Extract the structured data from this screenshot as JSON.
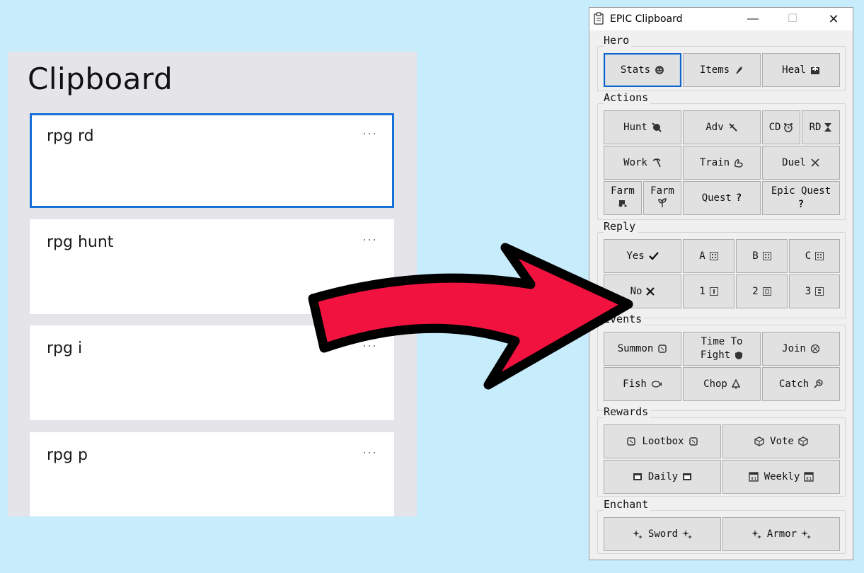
{
  "clipboard": {
    "title": "Clipboard",
    "more_label": "···",
    "items": [
      {
        "text": "rpg rd",
        "selected": true
      },
      {
        "text": "rpg hunt"
      },
      {
        "text": "rpg i"
      },
      {
        "text": "rpg p"
      }
    ]
  },
  "epic": {
    "window_title": "EPIC Clipboard",
    "controls": {
      "minimize": "—",
      "maximize": "☐",
      "close": "✕"
    },
    "hero": {
      "label": "Hero",
      "stats": "Stats",
      "items": "Items",
      "heal": "Heal"
    },
    "actions": {
      "label": "Actions",
      "hunt": "Hunt",
      "adv": "Adv",
      "cd": "CD",
      "rd": "RD",
      "work": "Work",
      "train": "Train",
      "duel": "Duel",
      "farm1": "Farm",
      "farm2": "Farm",
      "quest": "Quest",
      "epic_quest": "Epic Quest"
    },
    "reply": {
      "label": "Reply",
      "yes": "Yes",
      "a": "A",
      "b": "B",
      "c": "C",
      "no": "No",
      "one": "1",
      "two": "2",
      "three": "3"
    },
    "events": {
      "label": "Events",
      "summon": "Summon",
      "time_to": "Time To",
      "fight": "Fight",
      "join": "Join",
      "fish": "Fish",
      "chop": "Chop",
      "catch": "Catch"
    },
    "rewards": {
      "label": "Rewards",
      "lootbox": "Lootbox",
      "vote": "Vote",
      "daily": "Daily",
      "weekly": "Weekly"
    },
    "enchant": {
      "label": "Enchant",
      "sword": "Sword",
      "armor": "Armor"
    }
  },
  "colors": {
    "background": "#c7ecfb",
    "arrow": "#f21240",
    "focus": "#0d63c9"
  }
}
